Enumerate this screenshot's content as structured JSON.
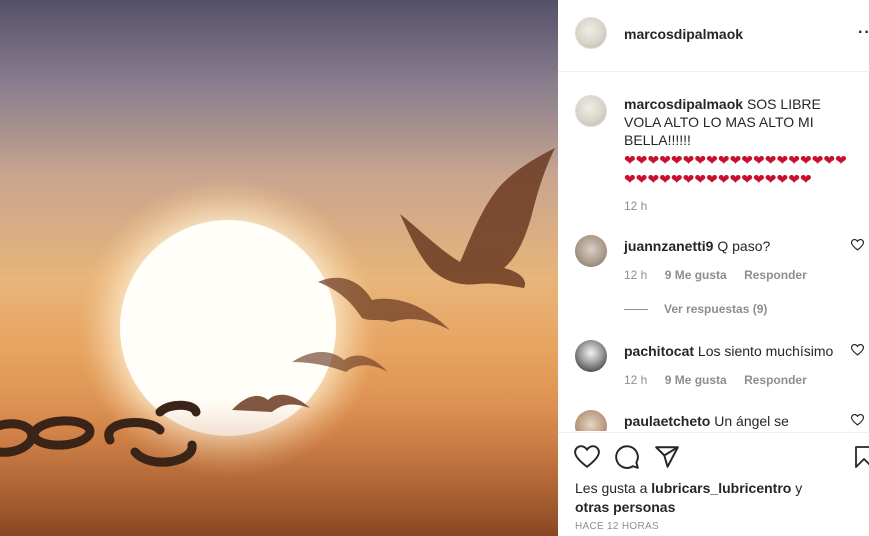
{
  "post": {
    "username": "marcosdipalmaok",
    "more_icon": "more-horizontal-icon",
    "caption": {
      "username": "marcosdipalmaok",
      "text": " SOS LIBRE VOLA ALTO LO MAS ALTO MI BELLA!!!!!!",
      "hearts": "❤❤❤❤❤❤❤❤❤❤❤❤❤❤❤❤❤❤❤❤❤❤❤❤❤❤❤❤❤❤❤❤❤❤❤",
      "time": "12 h"
    },
    "view_replies": "Ver respuestas (9)",
    "likes": {
      "prefix": "Les gusta a ",
      "user": "lubricars_lubricentro",
      "middle": " y ",
      "others": "otras personas"
    },
    "timestamp": "HACE 12 HORAS",
    "icons": [
      "heart-icon",
      "comment-icon",
      "share-icon",
      "bookmark-icon"
    ]
  },
  "comments": [
    {
      "username": "juannzanetti9",
      "text": " Q paso?",
      "time": "12 h",
      "likes": "9 Me gusta",
      "reply": "Responder"
    },
    {
      "username": "pachitocat",
      "text": " Los siento muchísimo",
      "time": "12 h",
      "likes": "9 Me gusta",
      "reply": "Responder"
    },
    {
      "username": "paulaetcheto",
      "text": " Un ángel se",
      "time": "",
      "likes": "",
      "reply": ""
    }
  ],
  "colors": {
    "heart_emoji": "#c8102e",
    "secondary_text": "#8e8e8e",
    "divider": "#efefef"
  }
}
